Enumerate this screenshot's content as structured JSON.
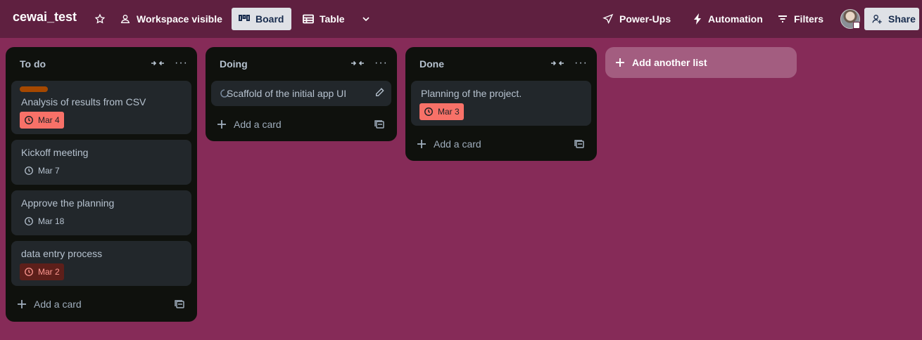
{
  "header": {
    "board_title": "cewai_test",
    "workspace_visibility": "Workspace visible",
    "view_board": "Board",
    "view_table": "Table",
    "power_ups": "Power-Ups",
    "automation": "Automation",
    "filters": "Filters",
    "share": "Share"
  },
  "lists": [
    {
      "title": "To do",
      "cards": [
        {
          "title": "Analysis of results from CSV",
          "label_color": "#a54800",
          "due": "Mar 4",
          "due_status": "overdue"
        },
        {
          "title": "Kickoff meeting",
          "due": "Mar 7",
          "due_status": "normal"
        },
        {
          "title": "Approve the planning",
          "due": "Mar 18",
          "due_status": "normal"
        },
        {
          "title": "data entry process",
          "due": "Mar 2",
          "due_status": "overdue-dark"
        }
      ],
      "add_card": "Add a card"
    },
    {
      "title": "Doing",
      "cards": [
        {
          "title": "Scaffold of the initial app UI",
          "icon": "loading-icon"
        }
      ],
      "add_card": "Add a card"
    },
    {
      "title": "Done",
      "cards": [
        {
          "title": "Planning of the project.",
          "due": "Mar 3",
          "due_status": "overdue"
        }
      ],
      "add_card": "Add a card"
    }
  ],
  "add_list": "Add another list",
  "colors": {
    "header_bg": "#5f2040",
    "board_bg": "#862b58",
    "list_bg": "#0f110d",
    "card_bg": "#22272b",
    "overdue": "#f87168",
    "overdue_dark": "#5d1f1a"
  }
}
